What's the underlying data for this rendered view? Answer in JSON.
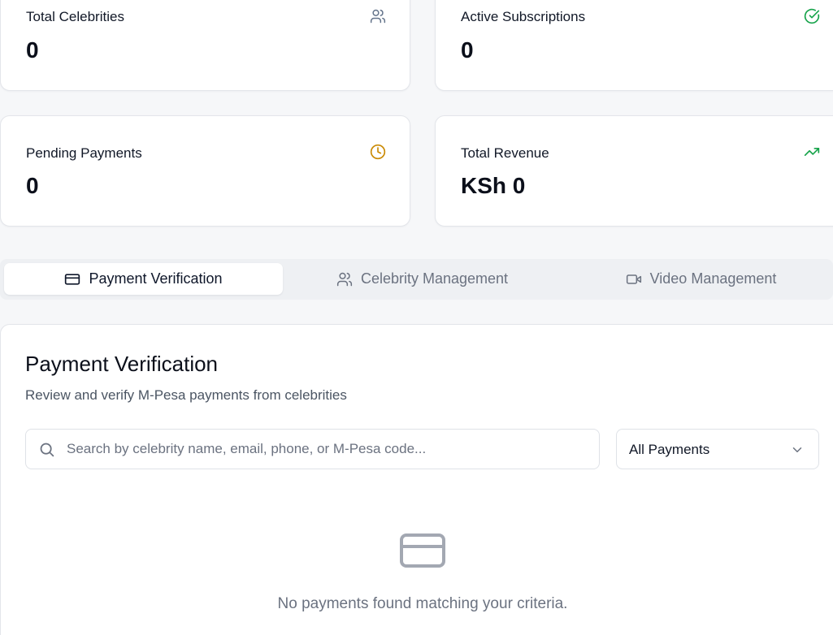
{
  "stats": [
    {
      "title": "Total Celebrities",
      "value": "0",
      "icon": "users-icon",
      "icon_color": "#64748b"
    },
    {
      "title": "Active Subscriptions",
      "value": "0",
      "icon": "check-circle-icon",
      "icon_color": "#16a34a"
    },
    {
      "title": "Pending Payments",
      "value": "0",
      "icon": "clock-icon",
      "icon_color": "#ca8a04"
    },
    {
      "title": "Total Revenue",
      "value": "KSh 0",
      "icon": "trending-up-icon",
      "icon_color": "#16a34a"
    }
  ],
  "tabs": [
    {
      "label": "Payment Verification",
      "icon": "credit-card-icon",
      "active": true
    },
    {
      "label": "Celebrity Management",
      "icon": "users-icon",
      "active": false
    },
    {
      "label": "Video Management",
      "icon": "video-icon",
      "active": false
    }
  ],
  "panel": {
    "title": "Payment Verification",
    "subtitle": "Review and verify M-Pesa payments from celebrities",
    "search_placeholder": "Search by celebrity name, email, phone, or M-Pesa code...",
    "search_value": "",
    "filter_selected": "All Payments",
    "empty_message": "No payments found matching your criteria."
  }
}
